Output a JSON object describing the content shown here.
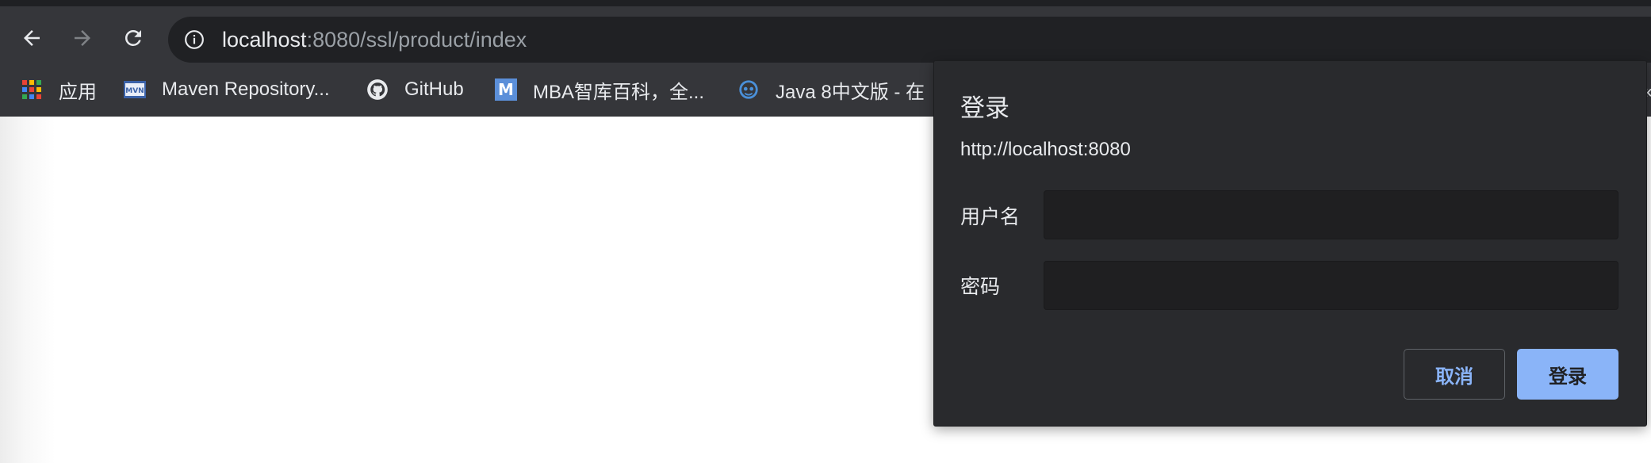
{
  "browser": {
    "url_host": "localhost",
    "url_path": ":8080/ssl/product/index"
  },
  "bookmarks": [
    {
      "label": "应用",
      "icon": "apps-grid-icon"
    },
    {
      "label": "Maven Repository...",
      "icon": "mvn-icon"
    },
    {
      "label": "GitHub",
      "icon": "github-icon"
    },
    {
      "label": "MBA智库百科，全...",
      "icon": "mba-icon"
    },
    {
      "label": "Java 8中文版 - 在",
      "icon": "java-icon"
    }
  ],
  "bookmarks_more": "«",
  "dialog": {
    "title": "登录",
    "origin": "http://localhost:8080",
    "username_label": "用户名",
    "username_value": "",
    "password_label": "密码",
    "password_value": "",
    "cancel_label": "取消",
    "login_label": "登录"
  },
  "colors": {
    "toolbar": "#35363a",
    "omnibox": "#202124",
    "dialog_bg": "#292a2d",
    "accent": "#8ab4f8"
  }
}
